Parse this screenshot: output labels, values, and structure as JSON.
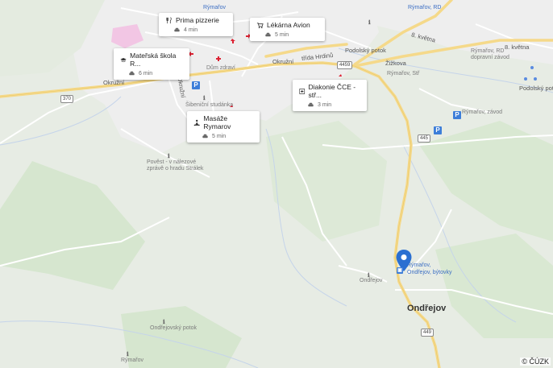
{
  "map": {
    "labels": {
      "rymarov_rd": "Rýmařov, RD",
      "dopravni_zavod": "dopravní závod",
      "rymarov_zavod": "Rýmařov, závod",
      "rymarov_str": "Rýmařov, Stř",
      "zizkova": "Žižkova",
      "podolsky": "Podolský potok",
      "podolsky2": "Podolský poto",
      "okruzni1": "Okružní",
      "okruzni2": "Okružní",
      "okruzni3": "Okružní",
      "trida_hrdinu": "třída Hrdinů",
      "kvetna8a": "8. května",
      "kvetna8b": "8. května",
      "domov": "Dům zdraví",
      "sibenicni": "Šibeniční studánka",
      "povest": "Pověst - v nálezové zprávě o hradu Strálek",
      "ondrejov_poi": "Ondřejov",
      "ondrejovsky_potok": "Ondřejovský potok",
      "rymarov_poi": "Rýmařov",
      "stop": "Rýmařov, Ondřejov, býtovky",
      "ondrejov_town": "Ondřejov",
      "rymarov_top": "Rýmařov",
      "road_370": "370",
      "road_4459": "4459",
      "road_445": "445",
      "road_449": "449"
    },
    "copyright": "© ČÚZK"
  },
  "cards": [
    {
      "name": "Prima pizzerie",
      "time": "4 min",
      "icon": "restaurant-icon"
    },
    {
      "name": "Lékárna Avion",
      "time": "5 min",
      "icon": "cart-icon"
    },
    {
      "name": "Mateřská škola R...",
      "time": "6 min",
      "icon": "school-icon"
    },
    {
      "name": "Diakonie ČCE - stř...",
      "time": "3 min",
      "icon": "hospital-icon"
    },
    {
      "name": "Masáže Rymarov",
      "time": "5 min",
      "icon": "massage-icon"
    }
  ]
}
